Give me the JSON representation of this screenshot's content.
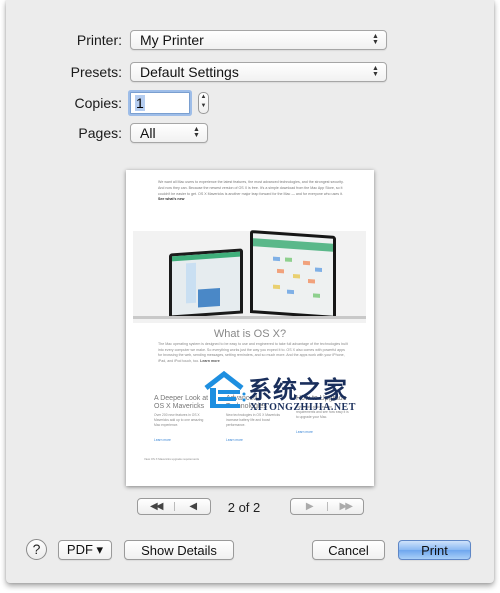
{
  "dialog": {
    "printer": {
      "label": "Printer:",
      "value": "My Printer"
    },
    "presets": {
      "label": "Presets:",
      "value": "Default Settings"
    },
    "copies": {
      "label": "Copies:",
      "value": "1"
    },
    "pages": {
      "label": "Pages:",
      "value": "All"
    }
  },
  "preview": {
    "intro": "We want all Mac users to experience the latest features, the most advanced technologies, and the strongest security. And now they can. Because the newest version of OS X is free. It's a simple download from the Mac App Store, so it couldn't be easier to get. OS X Mavericks is another major leap forward for the Mac — and for everyone who uses it.",
    "intro_link": "See what's new",
    "title": "What is OS X?",
    "body": "The Mac operating system is designed to be easy to use and engineered to take full advantage of the technologies built into every computer we make. So everything works just the way you expect it to. OS X also comes with powerful apps for browsing the web, sending messages, setting reminders, and so much more. And the apps work with your iPhone, iPad, and iPod touch, too.",
    "body_link": "Learn more",
    "columns": [
      {
        "heading": "A Deeper Look at OS X Mavericks",
        "text": "Over 200 new features in OS X Mavericks add up to one amazing Mac experience.",
        "link": "Learn more"
      },
      {
        "heading": "Advanced Technologies",
        "text": "New technologies in OS X Mavericks increase battery life and boost performance.",
        "link": "Learn more"
      },
      {
        "heading": "How to Upgrade",
        "text": "Get details about system requirements and see how easy it is to upgrade your Mac.",
        "link": "Learn more"
      }
    ],
    "footnote": "View OS X Mavericks upgrade requirements",
    "watermark": {
      "cn": "系统之家",
      "en": "XITONGZHIJIA.NET"
    }
  },
  "pager": {
    "first": "◀◀",
    "prev": "◀",
    "next": "▶",
    "last": "▶▶",
    "current": "2 of 2"
  },
  "buttons": {
    "help": "?",
    "pdf": "PDF ▾",
    "show_details": "Show Details",
    "cancel": "Cancel",
    "print": "Print"
  },
  "colors": {
    "accent": "#6ea6ee",
    "link": "#3a86d6",
    "sheet_bg": "#ececec"
  }
}
